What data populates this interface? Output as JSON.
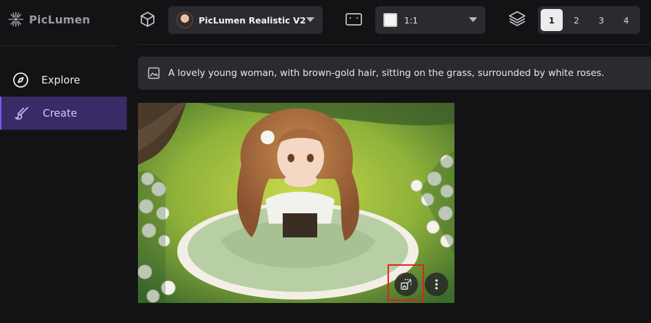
{
  "brand": {
    "name": "PicLumen",
    "logo_icon": "sunburst-logo-icon"
  },
  "sidebar": {
    "items": [
      {
        "label": "Explore",
        "icon": "compass-icon",
        "active": false
      },
      {
        "label": "Create",
        "icon": "brush-icon",
        "active": true
      }
    ]
  },
  "toolbar": {
    "model_icon": "cube-icon",
    "model": {
      "label": "PicLumen Realistic V2"
    },
    "ratio_icon": "aspect-ratio-icon",
    "ratio": {
      "label": "1:1"
    },
    "count_icon": "layers-icon",
    "counts": [
      "1",
      "2",
      "3",
      "4"
    ],
    "selected_count": "1"
  },
  "prompt": {
    "icon": "image-icon",
    "text": "A lovely young woman, with brown-gold hair, sitting on the grass, surrounded by white roses."
  },
  "generated_image": {
    "upscale_icon": "upscale-icon",
    "more_icon": "more-vertical-icon"
  },
  "colors": {
    "background": "#131315",
    "panel": "#2a2a2f",
    "accent": "#3a2a66",
    "accent_border": "#7a5cf0",
    "highlight": "#e0201e"
  }
}
